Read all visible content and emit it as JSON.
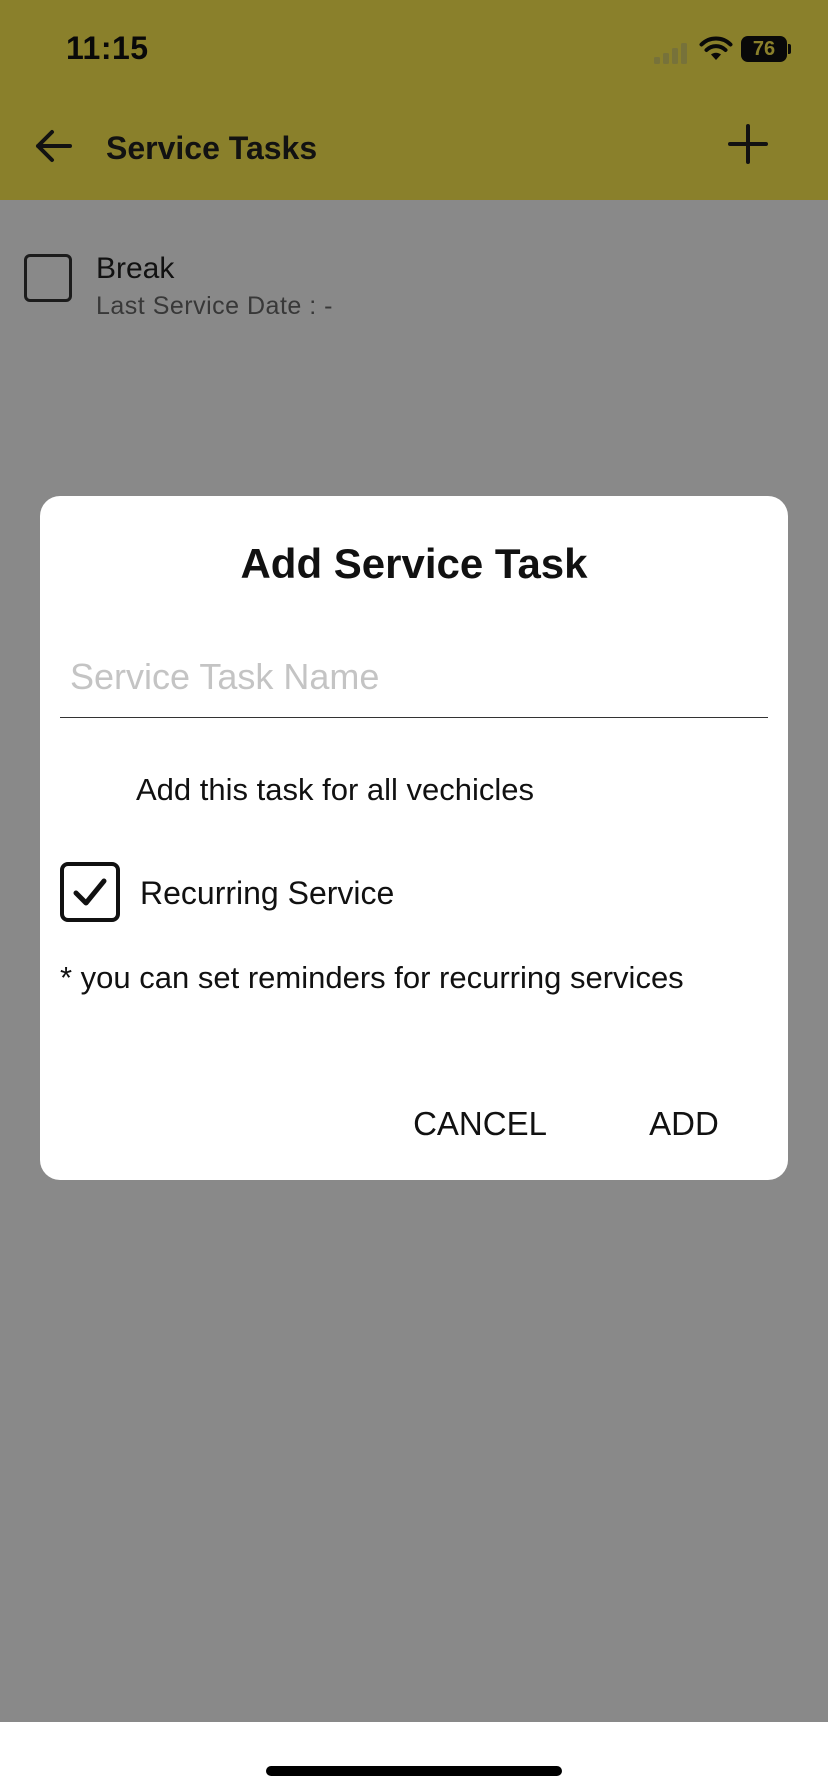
{
  "status_bar": {
    "time": "11:15",
    "battery_level": "76",
    "icons": [
      "cellular-signal-icon",
      "wifi-icon",
      "battery-icon"
    ]
  },
  "app_bar": {
    "title": "Service Tasks",
    "back_icon": "arrow-left-icon",
    "add_icon": "plus-icon",
    "background_color": "#fce94f"
  },
  "tasks": [
    {
      "name": "Break",
      "last_service": "Last Service Date : -",
      "checked": false
    }
  ],
  "dialog": {
    "title": "Add Service Task",
    "task_name_placeholder": "Service Task Name",
    "task_name_value": "",
    "all_vehicles_label": "Add this task for all vechicles",
    "recurring_label": "Recurring Service",
    "recurring_checked": true,
    "recurring_note": "* you can set reminders for recurring services",
    "cancel_label": "CANCEL",
    "add_label": "ADD"
  }
}
